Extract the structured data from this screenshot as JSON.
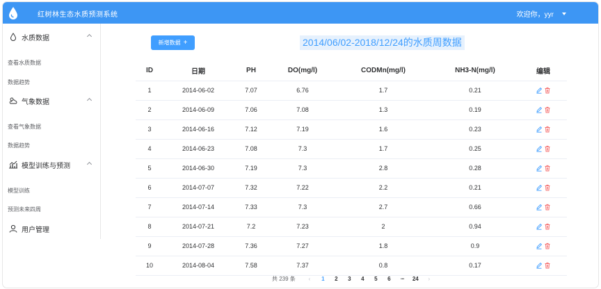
{
  "header": {
    "app_title": "红树林生态水质预测系统",
    "user_greeting": "欢迎你，yyr"
  },
  "sidebar": {
    "groups": [
      {
        "label": "水质数据",
        "icon": "water-drop-icon",
        "items": [
          "查看水质数据",
          "数据趋势"
        ]
      },
      {
        "label": "气象数据",
        "icon": "weather-icon",
        "items": [
          "查看气象数据",
          "数据趋势"
        ]
      },
      {
        "label": "模型训练与预测",
        "icon": "chart-icon",
        "items": [
          "模型训练",
          "预测未来四周"
        ]
      },
      {
        "label": "用户管理",
        "icon": "user-icon",
        "items": []
      }
    ]
  },
  "toolbar": {
    "add_label": "新增数据"
  },
  "page_title": "2014/06/02-2018/12/24的水质周数据",
  "table": {
    "columns": [
      "ID",
      "日期",
      "PH",
      "DO(mg/l)",
      "CODMn(mg/l)",
      "NH3-N(mg/l)",
      "编辑"
    ],
    "rows": [
      [
        "1",
        "2014-06-02",
        "7.07",
        "6.76",
        "1.7",
        "0.21"
      ],
      [
        "2",
        "2014-06-09",
        "7.06",
        "7.08",
        "1.3",
        "0.19"
      ],
      [
        "3",
        "2014-06-16",
        "7.12",
        "7.19",
        "1.6",
        "0.23"
      ],
      [
        "4",
        "2014-06-23",
        "7.08",
        "7.3",
        "1.7",
        "0.25"
      ],
      [
        "5",
        "2014-06-30",
        "7.19",
        "7.3",
        "2.8",
        "0.28"
      ],
      [
        "6",
        "2014-07-07",
        "7.32",
        "7.22",
        "2.2",
        "0.21"
      ],
      [
        "7",
        "2014-07-14",
        "7.33",
        "7.3",
        "2.7",
        "0.66"
      ],
      [
        "8",
        "2014-07-21",
        "7.2",
        "7.23",
        "2",
        "0.94"
      ],
      [
        "9",
        "2014-07-28",
        "7.36",
        "7.27",
        "1.8",
        "0.9"
      ],
      [
        "10",
        "2014-08-04",
        "7.58",
        "7.37",
        "0.8",
        "0.17"
      ]
    ]
  },
  "pagination": {
    "total_label": "共 239 条",
    "prev": "‹",
    "next": "›",
    "pages": [
      "1",
      "2",
      "3",
      "4",
      "5",
      "6",
      "···",
      "24"
    ],
    "current": "1"
  },
  "colors": {
    "header_bg": "#3d96f4",
    "primary": "#409eff",
    "danger": "#f56c6c"
  }
}
